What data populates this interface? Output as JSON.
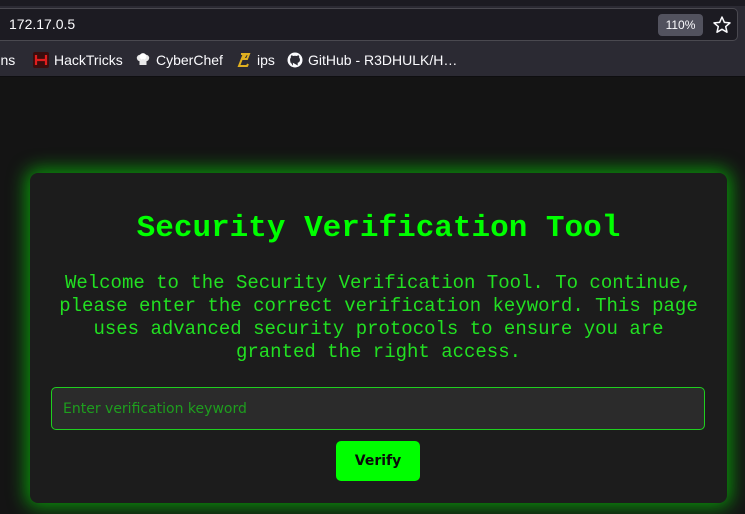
{
  "browser": {
    "url": "172.17.0.5",
    "zoom_level": "110%",
    "bookmark_icon": "star-icon",
    "bookmarks": [
      {
        "label": "Bins",
        "icon": "folder-icon"
      },
      {
        "label": "HackTricks",
        "icon": "hacktricks-icon"
      },
      {
        "label": "CyberChef",
        "icon": "chef-hat-icon"
      },
      {
        "label": "ips",
        "icon": "ips-icon"
      },
      {
        "label": "GitHub - R3DHULK/H…",
        "icon": "github-icon"
      }
    ]
  },
  "page": {
    "title": "Security Verification Tool",
    "description": "Welcome to the Security Verification Tool. To continue, please enter the correct verification keyword. This page uses advanced security protocols to ensure you are granted the right access.",
    "input": {
      "placeholder": "Enter verification keyword",
      "value": ""
    },
    "verify_label": "Verify"
  },
  "colors": {
    "accent": "#00ff00",
    "card_bg": "#1c1c1c",
    "page_bg": "#141414"
  }
}
